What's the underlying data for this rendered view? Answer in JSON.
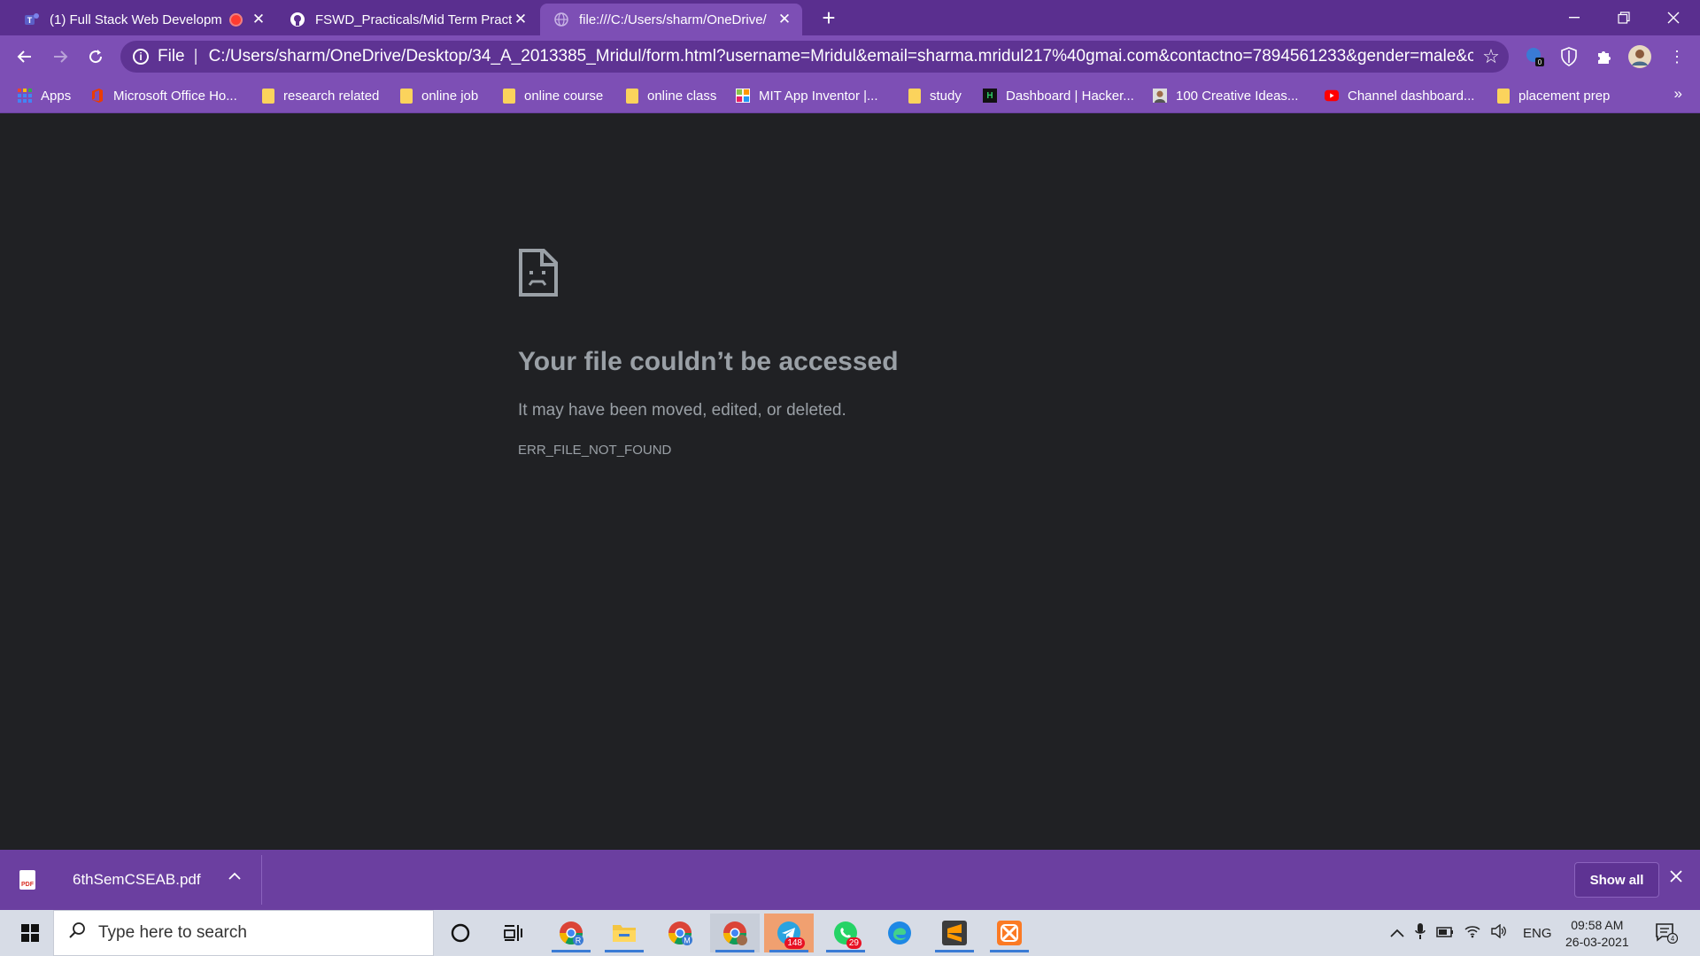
{
  "tabs": [
    {
      "title": "(1) Full Stack Web Developm",
      "icon": "teams-icon",
      "recording": true
    },
    {
      "title": "FSWD_Practicals/Mid Term Practi",
      "icon": "github-icon"
    },
    {
      "title": "file:///C:/Users/sharm/OneDrive/",
      "icon": "globe-icon",
      "active": true
    }
  ],
  "omnibox": {
    "scheme": "File",
    "url": "C:/Users/sharm/OneDrive/Desktop/34_A_2013385_Mridul/form.html?username=Mridul&email=sharma.mridul217%40gmai.com&contactno=7894561233&gender=male&city=Chennai"
  },
  "extensions": {
    "badge": "0"
  },
  "bookmarks": [
    {
      "label": "Apps",
      "icon": "apps-grid-icon"
    },
    {
      "label": "Microsoft Office Ho...",
      "icon": "office-icon"
    },
    {
      "label": "research related",
      "icon": "folder-icon"
    },
    {
      "label": "online job",
      "icon": "folder-icon"
    },
    {
      "label": "online course",
      "icon": "folder-icon"
    },
    {
      "label": "online class",
      "icon": "folder-icon"
    },
    {
      "label": "MIT App Inventor |...",
      "icon": "app-inventor-icon"
    },
    {
      "label": "study",
      "icon": "folder-icon"
    },
    {
      "label": "Dashboard | Hacker...",
      "icon": "hackerrank-icon"
    },
    {
      "label": "100 Creative Ideas...",
      "icon": "avatar-icon"
    },
    {
      "label": "Channel dashboard...",
      "icon": "youtube-icon"
    },
    {
      "label": "placement prep",
      "icon": "folder-icon"
    }
  ],
  "error": {
    "title": "Your file couldn’t be accessed",
    "subtitle": "It may have been moved, edited, or deleted.",
    "code": "ERR_FILE_NOT_FOUND"
  },
  "downloads": {
    "filename": "6thSemCSEAB.pdf",
    "pdf_tag": "PDF",
    "show_all": "Show all"
  },
  "taskbar": {
    "search_placeholder": "Type here to search",
    "apps": [
      {
        "name": "chrome-profile-r",
        "badge": "",
        "profile": "R"
      },
      {
        "name": "file-explorer",
        "badge": ""
      },
      {
        "name": "chrome-profile-m",
        "badge": "",
        "profile": "M"
      },
      {
        "name": "chrome-profile-photo",
        "badge": ""
      },
      {
        "name": "telegram",
        "badge": "148"
      },
      {
        "name": "whatsapp",
        "badge": "29"
      },
      {
        "name": "edge",
        "badge": ""
      },
      {
        "name": "sublime-text",
        "badge": ""
      },
      {
        "name": "xampp",
        "badge": ""
      }
    ],
    "language": "ENG",
    "time": "09:58 AM",
    "date": "26-03-2021",
    "notifications": "4"
  },
  "colors": {
    "frame": "#5a2f8f",
    "toolbar": "#7d4fb5",
    "content_bg": "#202124",
    "error_text": "#9aa0a6"
  }
}
